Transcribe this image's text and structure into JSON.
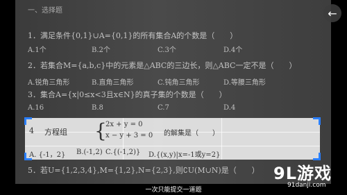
{
  "section_heading": "一、选择题",
  "questions": [
    {
      "text": "1．满足条件{0,1}∪A={0,1}的所有集合A的个数是（　　）",
      "options": [
        "A.1个",
        "B.2个",
        "C.3个",
        "D.4个"
      ]
    },
    {
      "text": "2．若集合M={a,b,c}中的元素是△ABC的三边长，则△ABC一定不是（　　）",
      "options": [
        "A.锐角三角形",
        "B.直角三角形",
        "C.钝角三角形",
        "D.等腰三角形"
      ]
    },
    {
      "text": "3．集合A={x|0≤x<3且x∈N}的真子集的个数是（　　）",
      "options": [
        "A.16",
        "B.8",
        "C.7",
        "D.4"
      ]
    }
  ],
  "selected_question": {
    "number": "4",
    "prefix": "方程组",
    "eq1": "2x + y = 0",
    "eq2": "x − y + 3 = 0",
    "suffix": "的解集是（　　）",
    "options": [
      "A. {-1，2}",
      "B.(-1,2)",
      "C.{(-1,2)}",
      "D.{(x,y)|x=-1或y=2}"
    ]
  },
  "next_question_text": "5．若U={1,2,3,4},M={1,2},N={2,3},则∁U(M∪N)是（　　）",
  "hint_text": "一次只能提交一道题",
  "watermark": {
    "main": "9L游戏",
    "sub": "91danji.com"
  },
  "colors": {
    "handle": "#2a7fff",
    "selection": "#e9e9e9"
  }
}
